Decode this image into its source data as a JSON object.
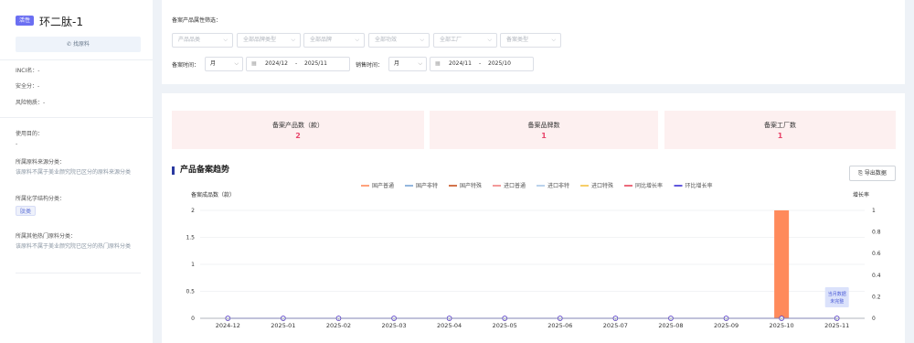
{
  "left": {
    "status_badge": "活性",
    "title": "环二肽-1",
    "find_button": "找原料",
    "inci_label": "INCI名：-",
    "safety_label": "安全分：-",
    "risk_label": "风险物质：-",
    "usage_label": "使用目的：",
    "usage_value": "-",
    "source_label": "所属原料来源分类：",
    "source_desc": "该原料不属于美业颜究院已区分的原料来源分类",
    "chem_label": "所属化学结构分类：",
    "chem_tag": "肽类",
    "hot_label": "所属其他热门原料分类：",
    "hot_desc": "该原料不属于美业颜究院已区分的热门原料分类"
  },
  "filters": {
    "title": "备案产品属性筛选：",
    "selects": [
      "产品品类",
      "全部品牌类型",
      "全部品牌",
      "全部功效",
      "全部工厂",
      "备案类型"
    ],
    "record_time_label": "备案时间：",
    "record_unit": "月",
    "record_start": "2024/12",
    "record_end": "2025/11",
    "sales_time_label": "销售时间：",
    "sales_unit": "月",
    "sales_start": "2024/11",
    "sales_end": "2025/10",
    "range_sep": "-"
  },
  "cards": [
    {
      "label": "备案产品数（款）",
      "value": "2"
    },
    {
      "label": "备案品牌数",
      "value": "1"
    },
    {
      "label": "备案工厂数",
      "value": "1"
    }
  ],
  "section": {
    "title": "产品备案趋势",
    "export_label": "导出数据"
  },
  "chart_data": {
    "type": "bar",
    "title": "产品备案趋势",
    "ylabel": "备案成品数（款）",
    "y2label": "增长率",
    "categories": [
      "2024-12",
      "2025-01",
      "2025-02",
      "2025-03",
      "2025-04",
      "2025-05",
      "2025-06",
      "2025-07",
      "2025-08",
      "2025-09",
      "2025-10",
      "2025-11"
    ],
    "ylim": [
      0,
      2
    ],
    "yticks": [
      "0",
      "0.5",
      "1",
      "1.5",
      "2"
    ],
    "y2lim": [
      0,
      1
    ],
    "y2ticks": [
      "0",
      "0.2",
      "0.4",
      "0.6",
      "0.8",
      "1"
    ],
    "series": [
      {
        "name": "国产普通",
        "color": "#ff8a5b",
        "type": "bar",
        "values": [
          0,
          0,
          0,
          0,
          0,
          0,
          0,
          0,
          0,
          0,
          2,
          0
        ]
      },
      {
        "name": "国产非特",
        "color": "#7aa5d6",
        "type": "bar",
        "values": [
          0,
          0,
          0,
          0,
          0,
          0,
          0,
          0,
          0,
          0,
          0,
          0
        ]
      },
      {
        "name": "国产特殊",
        "color": "#c8501e",
        "type": "bar",
        "values": [
          0,
          0,
          0,
          0,
          0,
          0,
          0,
          0,
          0,
          0,
          0,
          0
        ]
      },
      {
        "name": "进口普通",
        "color": "#f08080",
        "type": "bar",
        "values": [
          0,
          0,
          0,
          0,
          0,
          0,
          0,
          0,
          0,
          0,
          0,
          0
        ]
      },
      {
        "name": "进口非特",
        "color": "#a9c7e8",
        "type": "bar",
        "values": [
          0,
          0,
          0,
          0,
          0,
          0,
          0,
          0,
          0,
          0,
          0,
          0
        ]
      },
      {
        "name": "进口特殊",
        "color": "#f5c242",
        "type": "bar",
        "values": [
          0,
          0,
          0,
          0,
          0,
          0,
          0,
          0,
          0,
          0,
          0,
          0
        ]
      },
      {
        "name": "同比增长率",
        "color": "#e8455a",
        "type": "line",
        "values": [
          0,
          0,
          0,
          0,
          0,
          0,
          0,
          0,
          0,
          0,
          0,
          0
        ]
      },
      {
        "name": "环比增长率",
        "color": "#3a2fd6",
        "type": "line",
        "values": [
          0,
          0,
          0,
          0,
          0,
          0,
          0,
          0,
          0,
          0,
          0,
          0
        ]
      }
    ],
    "annotation": "当月数据未完整",
    "legend": "top"
  }
}
